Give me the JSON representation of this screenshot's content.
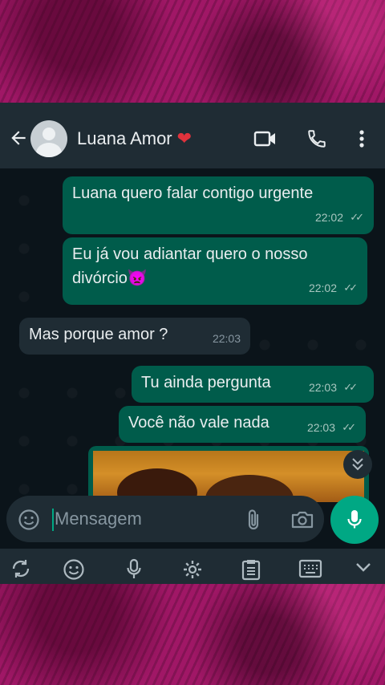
{
  "header": {
    "contact_name": "Luana Amor",
    "heart": "❤",
    "icons": [
      "back-arrow-icon",
      "video-call-icon",
      "voice-call-icon",
      "more-vert-icon"
    ]
  },
  "messages": [
    {
      "direction": "out",
      "text": "Luana quero falar contigo urgente",
      "time": "22:02",
      "status": "read"
    },
    {
      "direction": "out",
      "text": "Eu já vou adiantar quero o nosso divórcio",
      "emoji": "👿",
      "time": "22:02",
      "status": "read"
    },
    {
      "direction": "in",
      "text": "Mas porque amor ?",
      "time": "22:03"
    },
    {
      "direction": "out",
      "text": "Tu ainda pergunta",
      "time": "22:03",
      "status": "read"
    },
    {
      "direction": "out",
      "text": "Você não vale nada",
      "time": "22:03",
      "status": "read"
    }
  ],
  "composer": {
    "placeholder": "Mensagem",
    "icons": [
      "emoji-icon",
      "attach-clip-icon",
      "camera-icon",
      "mic-icon"
    ]
  },
  "keyboard_toolbar": {
    "icons": [
      "sync-icon",
      "emoji-icon",
      "mic-icon",
      "settings-icon",
      "clipboard-icon",
      "keyboard-icon",
      "chevron-down-icon"
    ]
  },
  "colors": {
    "header_bg": "#1f2c34",
    "chat_bg": "#0b141a",
    "outgoing_bubble": "#005c4b",
    "incoming_bubble": "#1f2c34",
    "accent": "#00a884",
    "frame_bg": "#a01766"
  }
}
